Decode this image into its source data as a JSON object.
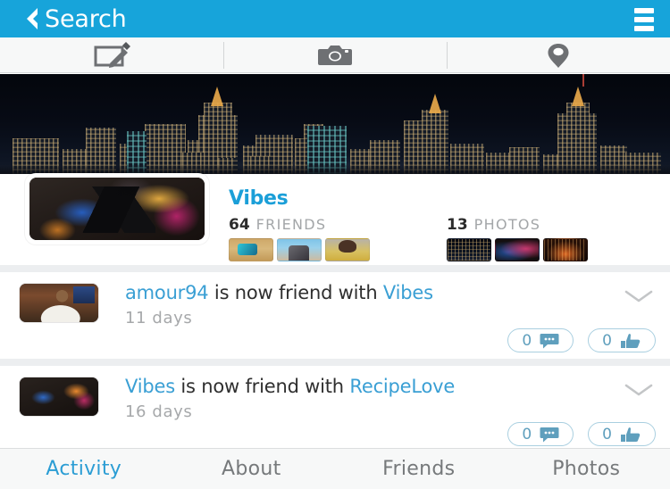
{
  "navbar": {
    "back_label": "Search",
    "back_icon": "chevron-left-icon",
    "menu_icon": "menu-icon",
    "background_color": "#17a4da"
  },
  "toolbar": {
    "items": [
      {
        "icon": "compose-icon",
        "name": "compose-button"
      },
      {
        "icon": "camera-icon",
        "name": "camera-button"
      },
      {
        "icon": "location-pin-icon",
        "name": "location-button"
      }
    ]
  },
  "cover": {
    "name": "cover-photo",
    "description": "night city skyline"
  },
  "profile": {
    "avatar_name": "profile-avatar",
    "name": "Vibes",
    "name_color": "#1b9fd8",
    "friends": {
      "count": "64",
      "label": "FRIENDS",
      "thumbs": [
        "friend-thumb-1",
        "friend-thumb-2",
        "friend-thumb-3"
      ]
    },
    "photos": {
      "count": "13",
      "label": "PHOTOS",
      "thumbs": [
        "photo-thumb-1",
        "photo-thumb-2",
        "photo-thumb-3"
      ]
    }
  },
  "feed": {
    "items": [
      {
        "avatar": "amour94-avatar",
        "actor": "amour94",
        "action": " is now friend with ",
        "target": "Vibes",
        "time": "11 days",
        "comment_count": "0",
        "like_count": "0",
        "comment_icon": "comment-bubble-icon",
        "like_icon": "thumbs-up-icon",
        "expand_icon": "chevron-down-icon"
      },
      {
        "avatar": "vibes-avatar",
        "actor": "Vibes",
        "action": " is now friend with ",
        "target": "RecipeLove",
        "time": "16 days",
        "comment_count": "0",
        "like_count": "0",
        "comment_icon": "comment-bubble-icon",
        "like_icon": "thumbs-up-icon",
        "expand_icon": "chevron-down-icon"
      }
    ]
  },
  "tabbar": {
    "active_color": "#2b9dd4",
    "tabs": [
      {
        "label": "Activity",
        "active": true
      },
      {
        "label": "About",
        "active": false
      },
      {
        "label": "Friends",
        "active": false
      },
      {
        "label": "Photos",
        "active": false
      }
    ]
  }
}
